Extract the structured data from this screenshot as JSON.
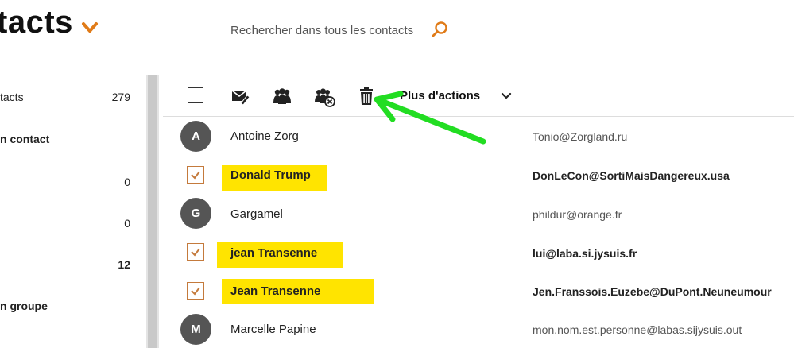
{
  "header": {
    "title": "tacts",
    "search_placeholder": "Rechercher dans tous les contacts"
  },
  "sidebar": {
    "items": [
      {
        "label": "tacts",
        "count": "279"
      },
      {
        "label": "n contact",
        "count": ""
      },
      {
        "label": "",
        "count": "0"
      },
      {
        "label": "",
        "count": "0"
      },
      {
        "label": "",
        "count": "12"
      },
      {
        "label": "n groupe",
        "count": ""
      }
    ]
  },
  "toolbar": {
    "more_actions_label": "Plus d'actions",
    "icons": [
      "select-all-checkbox",
      "email-edit-icon",
      "group-icon",
      "group-remove-icon",
      "trash-icon"
    ]
  },
  "contacts": [
    {
      "avatar": "A",
      "name": "Antoine Zorg",
      "email": "Tonio@Zorgland.ru",
      "selected": false
    },
    {
      "avatar": "",
      "name": "Donald Trump",
      "email": "DonLeCon@SortiMaisDangereux.usa",
      "selected": true
    },
    {
      "avatar": "G",
      "name": "Gargamel",
      "email": "phildur@orange.fr",
      "selected": false
    },
    {
      "avatar": "",
      "name": "jean Transenne",
      "email": "lui@laba.si.jysuis.fr",
      "selected": true
    },
    {
      "avatar": "",
      "name": "Jean Transenne",
      "email": "Jen.Franssois.Euzebe@DuPont.Neuneumour",
      "selected": true
    },
    {
      "avatar": "M",
      "name": "Marcelle Papine",
      "email": "mon.nom.est.personne@labas.sijysuis.out",
      "selected": false
    }
  ],
  "colors": {
    "accent_orange": "#e07b18",
    "highlight_yellow": "#ffe400",
    "annotation_arrow": "#22dd22",
    "avatar_gray": "#555555"
  }
}
